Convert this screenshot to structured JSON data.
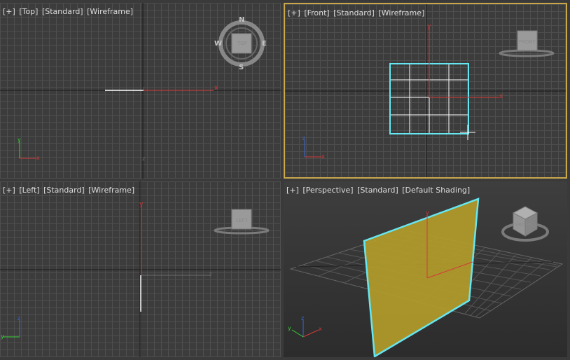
{
  "viewports": {
    "top": {
      "plus": "[+]",
      "view": "[Top]",
      "shading_mode": "[Standard]",
      "render": "[Wireframe]",
      "cube_label": "TOP",
      "compass": {
        "n": "N",
        "s": "S",
        "e": "E",
        "w": "W"
      }
    },
    "front": {
      "plus": "[+]",
      "view": "[Front]",
      "shading_mode": "[Standard]",
      "render": "[Wireframe]",
      "cube_label": "FRONT"
    },
    "left": {
      "plus": "[+]",
      "view": "[Left]",
      "shading_mode": "[Standard]",
      "render": "[Wireframe]",
      "cube_label": "LEFT"
    },
    "perspective": {
      "plus": "[+]",
      "view": "[Perspective]",
      "shading_mode": "[Standard]",
      "render": "[Default Shading]",
      "cube_label": "FRONT"
    }
  },
  "axes": {
    "x": "x",
    "y": "y",
    "z": "z"
  },
  "colors": {
    "active_border": "#c9a84c",
    "selection": "#66e6f0",
    "plane_fill": "#b39c2a",
    "axis_x": "#d23a3a",
    "axis_y": "#3ad23a",
    "axis_z": "#3a6ad2"
  },
  "icons": {
    "viewcube": "viewcube-icon",
    "compass": "compass-icon",
    "cursor": "move-cursor-icon",
    "axis_tripod": "axis-tripod-icon"
  }
}
